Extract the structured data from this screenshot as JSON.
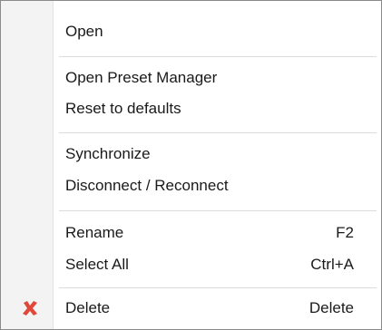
{
  "menu": {
    "items": [
      {
        "label": "Open"
      },
      {
        "label": "Open Preset Manager"
      },
      {
        "label": "Reset to defaults"
      },
      {
        "label": "Synchronize"
      },
      {
        "label": "Disconnect / Reconnect"
      },
      {
        "label": "Rename",
        "shortcut": "F2"
      },
      {
        "label": "Select All",
        "shortcut": "Ctrl+A"
      },
      {
        "label": "Delete",
        "shortcut": "Delete",
        "icon": "delete-x-icon",
        "icon_color": "#e0483c"
      }
    ]
  }
}
